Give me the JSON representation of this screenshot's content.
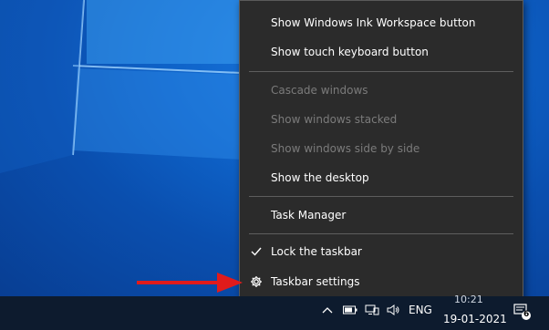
{
  "menu": {
    "items": [
      {
        "label": "Show Windows Ink Workspace button",
        "enabled": true
      },
      {
        "label": "Show touch keyboard button",
        "enabled": true
      },
      {
        "label": "Cascade windows",
        "enabled": false
      },
      {
        "label": "Show windows stacked",
        "enabled": false
      },
      {
        "label": "Show windows side by side",
        "enabled": false
      },
      {
        "label": "Show the desktop",
        "enabled": true
      },
      {
        "label": "Task Manager",
        "enabled": true
      },
      {
        "label": "Lock the taskbar",
        "enabled": true,
        "checked": true,
        "icon": "checkmark-icon"
      },
      {
        "label": "Taskbar settings",
        "enabled": true,
        "icon": "gear-icon"
      }
    ]
  },
  "taskbar": {
    "language": "ENG",
    "time": "10:21",
    "date": "19-01-2021",
    "notification_count": "6"
  },
  "colors": {
    "menu_bg": "#2b2b2b",
    "disabled_text": "#7b7b7b",
    "arrow": "#e11b1b"
  }
}
